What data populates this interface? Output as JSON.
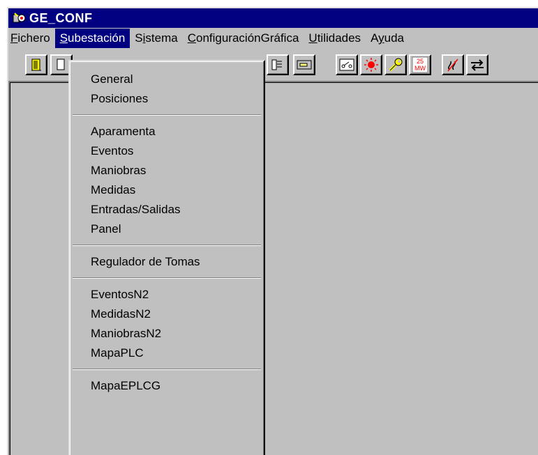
{
  "window": {
    "title": "GE_CONF"
  },
  "menubar": {
    "items": [
      {
        "underline": "F",
        "rest": "ichero"
      },
      {
        "underline": "S",
        "rest": "ubestación"
      },
      {
        "pre": "S",
        "underline": "i",
        "rest": "stema"
      },
      {
        "underline": "C",
        "rest": "onfiguraciónGráfica"
      },
      {
        "underline": "U",
        "rest": "tilidades"
      },
      {
        "pre": "A",
        "underline": "y",
        "rest": "uda"
      }
    ],
    "active_index": 1
  },
  "toolbar": {
    "icons": [
      "exit-door-icon",
      "document-icon",
      "panel-icon",
      "display-icon",
      "switch-icon",
      "alarm-icon",
      "wrench-icon",
      "measure-icon",
      "link-icon",
      "exchange-icon"
    ],
    "measure_badge": {
      "top": "25",
      "bottom": "MW"
    }
  },
  "dropdown": {
    "groups": [
      [
        "General",
        "Posiciones"
      ],
      [
        "Aparamenta",
        "Eventos",
        "Maniobras",
        "Medidas",
        "Entradas/Salidas",
        "Panel"
      ],
      [
        "Regulador de Tomas"
      ],
      [
        "EventosN2",
        "MedidasN2",
        "ManiobrasN2",
        "MapaPLC"
      ],
      [
        "MapaEPLCG"
      ]
    ]
  },
  "colors": {
    "titlebar": "#000080",
    "face": "#c0c0c0",
    "highlight": "#000080",
    "alarm": "#ff0000"
  }
}
